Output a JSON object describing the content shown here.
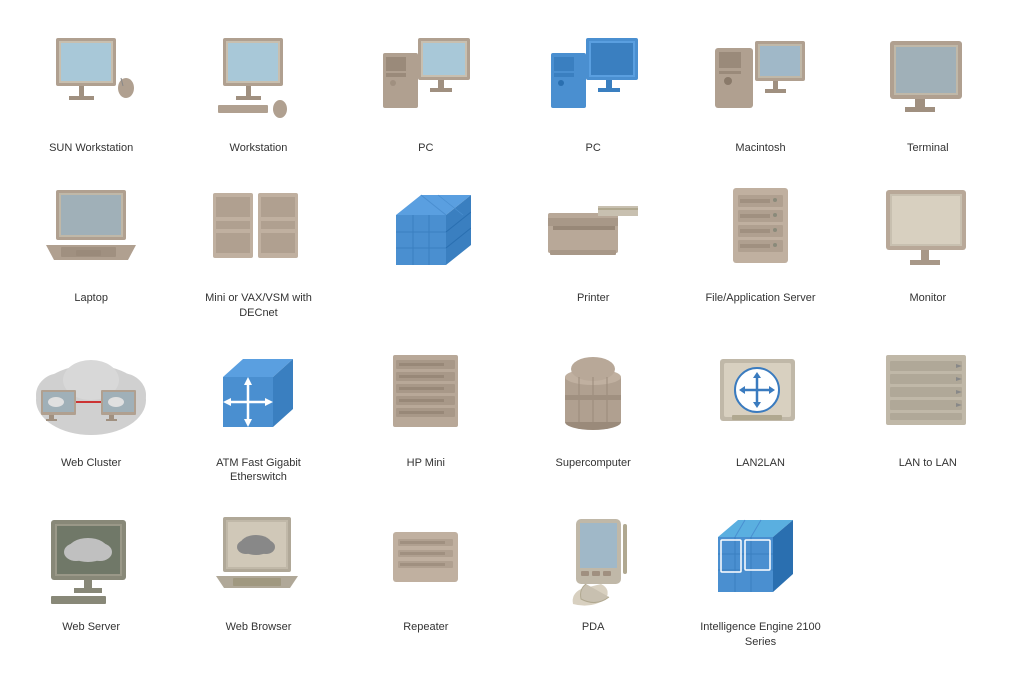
{
  "items": [
    {
      "id": "sun-workstation",
      "label": "SUN Workstation"
    },
    {
      "id": "workstation",
      "label": "Workstation"
    },
    {
      "id": "pc-gray",
      "label": "PC"
    },
    {
      "id": "pc-blue",
      "label": "PC"
    },
    {
      "id": "macintosh",
      "label": "Macintosh"
    },
    {
      "id": "terminal",
      "label": "Terminal"
    },
    {
      "id": "laptop",
      "label": "Laptop"
    },
    {
      "id": "mini-vax",
      "label": "Mini or VAX/VSM with DECnet"
    },
    {
      "id": "blue-cube",
      "label": ""
    },
    {
      "id": "printer",
      "label": "Printer"
    },
    {
      "id": "file-server",
      "label": "File/Application Server"
    },
    {
      "id": "monitor",
      "label": "Monitor"
    },
    {
      "id": "web-cluster",
      "label": "Web Cluster"
    },
    {
      "id": "atm-switch",
      "label": "ATM Fast Gigabit Etherswitch"
    },
    {
      "id": "hp-mini",
      "label": "HP Mini"
    },
    {
      "id": "supercomputer",
      "label": "Supercomputer"
    },
    {
      "id": "lan2lan",
      "label": "LAN2LAN"
    },
    {
      "id": "lan-to-lan",
      "label": "LAN to LAN"
    },
    {
      "id": "web-server",
      "label": "Web Server"
    },
    {
      "id": "web-browser",
      "label": "Web Browser"
    },
    {
      "id": "repeater",
      "label": "Repeater"
    },
    {
      "id": "pda",
      "label": "PDA"
    },
    {
      "id": "intelligence-engine",
      "label": "Intelligence Engine 2100 Series"
    },
    {
      "id": "empty",
      "label": ""
    }
  ]
}
